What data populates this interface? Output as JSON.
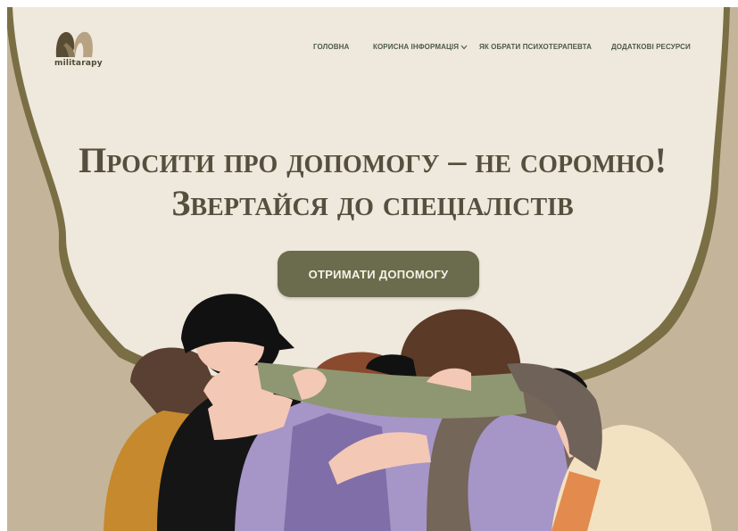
{
  "brand": {
    "name": "militarapy",
    "logo_icon": "m-logo-icon"
  },
  "nav": {
    "items": [
      {
        "label": "ГОЛОВНА"
      },
      {
        "label": "КОРИСНА ІНФОРМАЦІЯ"
      },
      {
        "label": "ЯК ОБРАТИ ПСИХОТЕРАПЕВТА"
      },
      {
        "label": "ДОДАТКОВІ РЕСУРСИ"
      }
    ],
    "dropdown_icon": "chevron-down-icon"
  },
  "hero": {
    "title_line1": "Просити про допомогу – не соромно!",
    "title_line2": "Звертайся до спеціалістів",
    "cta_label": "ОТРИМАТИ ДОПОМОГУ",
    "illustration": "group-hug-illustration"
  },
  "colors": {
    "page_bg": "#c4b59a",
    "hero_bg": "#efe8dc",
    "border": "#7a6e44",
    "title": "#55503e",
    "nav_text": "#4e5a4a",
    "button_bg": "#6b6c4d",
    "button_text": "#f6f2e6"
  }
}
